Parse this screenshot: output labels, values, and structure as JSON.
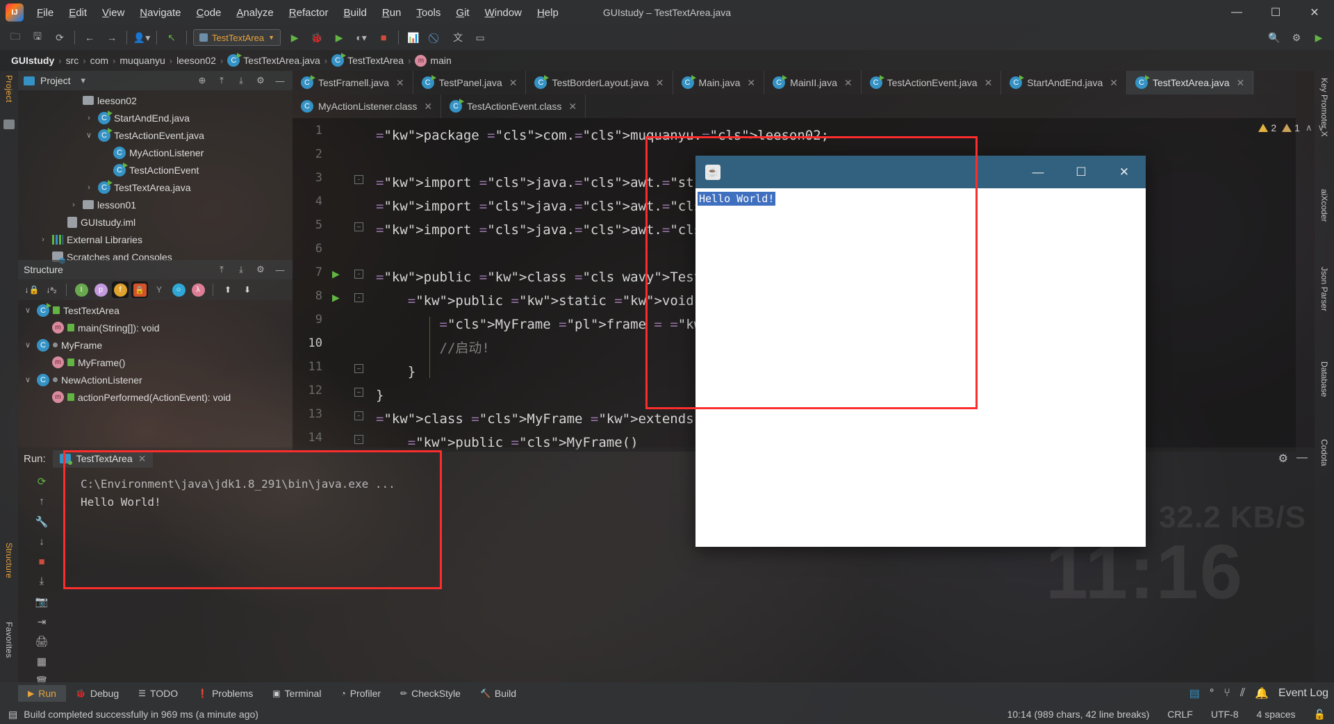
{
  "window": {
    "title": "GUIstudy – TestTextArea.java",
    "controls": {
      "minimize": "—",
      "maximize": "☐",
      "close": "✕"
    }
  },
  "menubar": {
    "logo": "intellij-logo",
    "items": [
      "File",
      "Edit",
      "View",
      "Navigate",
      "Code",
      "Analyze",
      "Refactor",
      "Build",
      "Run",
      "Tools",
      "Git",
      "Window",
      "Help"
    ]
  },
  "toolbar": {
    "run_config": "TestTextArea",
    "icons": [
      "open-folder-icon",
      "save-icon",
      "sync-icon",
      "back-arrow-icon",
      "forward-arrow-icon",
      "user-icon",
      "undo-icon",
      "run-icon",
      "debug-icon",
      "run-coverage-icon",
      "profile-icon",
      "stop-icon",
      "chart-icon",
      "no-icon",
      "translate-icon",
      "terminal-icon"
    ],
    "right_icons": [
      "search-icon",
      "settings-icon",
      "play-store-icon"
    ]
  },
  "breadcrumb": [
    {
      "label": "GUIstudy",
      "icon": "",
      "bold": true
    },
    {
      "label": "src",
      "icon": ""
    },
    {
      "label": "com",
      "icon": ""
    },
    {
      "label": "muquanyu",
      "icon": ""
    },
    {
      "label": "leeson02",
      "icon": ""
    },
    {
      "label": "TestTextArea.java",
      "icon": "java-class-icon"
    },
    {
      "label": "TestTextArea",
      "icon": "java-class-icon"
    },
    {
      "label": "main",
      "icon": "method-icon"
    }
  ],
  "left_rail": {
    "project": "Project",
    "structure": "Structure",
    "favorites": "Favorites"
  },
  "right_rail": {
    "items": [
      "Key Promoter X",
      "aiXcoder",
      "Json Parser",
      "Database",
      "Codota"
    ]
  },
  "project_panel": {
    "title": "Project",
    "header_icons": [
      "locate-icon",
      "expand-all-icon",
      "collapse-all-icon",
      "gear-icon",
      "minimize-icon"
    ],
    "tree": [
      {
        "label": "leeson02",
        "indent": 3,
        "arrow": "",
        "icon": "folder-icon"
      },
      {
        "label": "StartAndEnd.java",
        "indent": 4,
        "arrow": "›",
        "icon": "java-class-icon"
      },
      {
        "label": "TestActionEvent.java",
        "indent": 4,
        "arrow": "∨",
        "icon": "java-class-icon"
      },
      {
        "label": "MyActionListener",
        "indent": 5,
        "arrow": "",
        "icon": "class-icon"
      },
      {
        "label": "TestActionEvent",
        "indent": 5,
        "arrow": "",
        "icon": "java-class-icon"
      },
      {
        "label": "TestTextArea.java",
        "indent": 4,
        "arrow": "›",
        "icon": "java-class-icon"
      },
      {
        "label": "lesson01",
        "indent": 3,
        "arrow": "›",
        "icon": "folder-icon"
      },
      {
        "label": "GUIstudy.iml",
        "indent": 2,
        "arrow": "",
        "icon": "iml-file-icon"
      },
      {
        "label": "External Libraries",
        "indent": 1,
        "arrow": "›",
        "icon": "libraries-icon"
      },
      {
        "label": "Scratches and Consoles",
        "indent": 1,
        "arrow": "",
        "icon": "scratches-icon"
      }
    ]
  },
  "structure_panel": {
    "title": "Structure",
    "header_icons": [
      "expand-all-icon",
      "collapse-all-icon",
      "gear-icon",
      "minimize-icon"
    ],
    "toolbar_icons": [
      "sort-by-visibility-icon",
      "sort-alphabetically-icon",
      "show-inherited-icon",
      "show-properties-icon",
      "show-fields-icon",
      "show-non-public-icon",
      "show-anonymous-icon",
      "show-interfaces-icon",
      "show-lambdas-icon",
      "expand-icon",
      "collapse-icon"
    ],
    "tree": [
      {
        "label": "TestTextArea",
        "indent": 0,
        "arrow": "∨",
        "icon": "java-class-icon",
        "badge": "public-lock-icon"
      },
      {
        "label": "main(String[]): void",
        "indent": 1,
        "arrow": "",
        "icon": "method-icon",
        "badge": "public-lock-icon"
      },
      {
        "label": "MyFrame",
        "indent": 0,
        "arrow": "∨",
        "icon": "class-icon",
        "badge": "package-private-icon"
      },
      {
        "label": "MyFrame()",
        "indent": 1,
        "arrow": "",
        "icon": "method-icon",
        "badge": "public-lock-icon"
      },
      {
        "label": "NewActionListener",
        "indent": 0,
        "arrow": "∨",
        "icon": "class-icon",
        "badge": "package-private-icon"
      },
      {
        "label": "actionPerformed(ActionEvent): void",
        "indent": 1,
        "arrow": "",
        "icon": "method-icon",
        "badge": "public-lock-icon"
      }
    ]
  },
  "editor_tabs_row1": [
    {
      "label": "TestFramell.java",
      "icon": "java-class-icon",
      "active": false
    },
    {
      "label": "TestPanel.java",
      "icon": "java-class-icon",
      "active": false
    },
    {
      "label": "TestBorderLayout.java",
      "icon": "java-class-icon",
      "active": false
    },
    {
      "label": "Main.java",
      "icon": "java-class-icon",
      "active": false
    },
    {
      "label": "MainII.java",
      "icon": "java-class-icon",
      "active": false
    },
    {
      "label": "TestActionEvent.java",
      "icon": "java-class-icon",
      "active": false
    },
    {
      "label": "StartAndEnd.java",
      "icon": "java-class-icon",
      "active": false
    },
    {
      "label": "TestTextArea.java",
      "icon": "java-class-icon",
      "active": true
    }
  ],
  "editor_tabs_row2": [
    {
      "label": "MyActionListener.class",
      "icon": "class-icon",
      "active": false
    },
    {
      "label": "TestActionEvent.class",
      "icon": "java-class-icon",
      "active": false
    }
  ],
  "inspections": {
    "warnings": "2",
    "weak_warnings": "1",
    "up_arrow": "∧",
    "down_arrow": "∨"
  },
  "code": {
    "lines": [
      {
        "n": "1",
        "text": "package com.muquanyu.leeson02;"
      },
      {
        "n": "2",
        "text": ""
      },
      {
        "n": "3",
        "text": "import java.awt.*;"
      },
      {
        "n": "4",
        "text": "import java.awt.event.ActionEvent;"
      },
      {
        "n": "5",
        "text": "import java.awt.event.ActionListener;"
      },
      {
        "n": "6",
        "text": ""
      },
      {
        "n": "7",
        "text": "public class TestTextArea {"
      },
      {
        "n": "8",
        "text": "    public static void main(String[] args) {"
      },
      {
        "n": "9",
        "text": "        MyFrame frame = new MyFrame();"
      },
      {
        "n": "10",
        "text": "        //启动!"
      },
      {
        "n": "11",
        "text": "    }"
      },
      {
        "n": "12",
        "text": "}"
      },
      {
        "n": "13",
        "text": "class MyFrame extends Frame{"
      },
      {
        "n": "14",
        "text": "    public MyFrame()"
      }
    ],
    "current_line": "10"
  },
  "awt_window": {
    "icon": "java-coffee-cup-icon",
    "minimize": "—",
    "maximize": "☐",
    "close": "✕",
    "text_content": "Hello World!"
  },
  "run_panel": {
    "label": "Run:",
    "tab": "TestTextArea",
    "close": "✕",
    "side_icons": [
      "rerun-icon",
      "up-arrow-icon",
      "wrench-icon",
      "down-arrow-icon",
      "stop-icon",
      "scroll-to-end-icon",
      "camera-icon",
      "print-icon",
      "export-icon",
      "layout-icon",
      "trash-icon"
    ],
    "gear": "gear-icon",
    "minimize": "—",
    "console_lines": [
      "C:\\Environment\\java\\jdk1.8_291\\bin\\java.exe ...",
      "Hello World!"
    ]
  },
  "bottom_bar": {
    "items": [
      {
        "label": "Run",
        "icon": "run-icon",
        "active": true
      },
      {
        "label": "Debug",
        "icon": "debug-icon",
        "active": false
      },
      {
        "label": "TODO",
        "icon": "todo-icon",
        "active": false
      },
      {
        "label": "Problems",
        "icon": "problems-icon",
        "active": false
      },
      {
        "label": "Terminal",
        "icon": "terminal-icon",
        "active": false
      },
      {
        "label": "Profiler",
        "icon": "profiler-icon",
        "active": false
      },
      {
        "label": "CheckStyle",
        "icon": "checkstyle-icon",
        "active": false
      },
      {
        "label": "Build",
        "icon": "build-icon",
        "active": false
      }
    ],
    "right": {
      "event_log": "Event Log",
      "icons": [
        "layout-icon",
        "degree-icon",
        "branch-icon",
        "split-icon",
        "bell-icon"
      ]
    }
  },
  "status_bar": {
    "message": "Build completed successfully in 969 ms (a minute ago)",
    "caret": "10:14 (989 chars, 42 line breaks)",
    "line_sep": "CRLF",
    "encoding": "UTF-8",
    "indent": "4 spaces"
  },
  "wallpaper": {
    "speed": "32.2 KB/S",
    "clock": "11:16"
  },
  "colors": {
    "accent_orange": "#e8a33d",
    "keyword": "#cc7832",
    "class_blue": "#6ab0e3",
    "annotation_red": "#fb2d2d",
    "awt_titlebar": "#31617f",
    "selection_blue": "#3f6fbf"
  }
}
